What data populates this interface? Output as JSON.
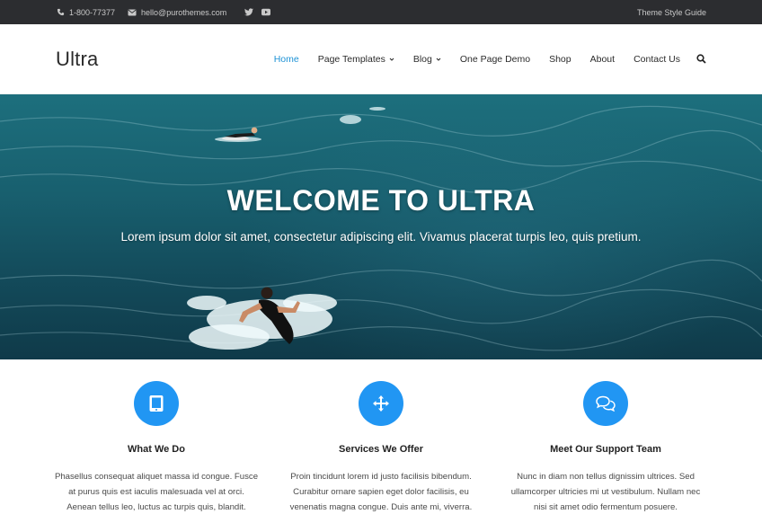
{
  "topbar": {
    "phone": "1-800-77377",
    "email": "hello@purothemes.com",
    "right_link": "Theme Style Guide",
    "icons": [
      "phone-icon",
      "mail-icon",
      "twitter-icon",
      "youtube-icon"
    ]
  },
  "header": {
    "logo": "Ultra",
    "nav": [
      {
        "label": "Home",
        "active": true,
        "dropdown": false
      },
      {
        "label": "Page Templates",
        "active": false,
        "dropdown": true
      },
      {
        "label": "Blog",
        "active": false,
        "dropdown": true
      },
      {
        "label": "One Page Demo",
        "active": false,
        "dropdown": false
      },
      {
        "label": "Shop",
        "active": false,
        "dropdown": false
      },
      {
        "label": "About",
        "active": false,
        "dropdown": false
      },
      {
        "label": "Contact Us",
        "active": false,
        "dropdown": false
      }
    ],
    "search_icon": "search-icon"
  },
  "hero": {
    "title": "WELCOME TO ULTRA",
    "subtitle": "Lorem ipsum dolor sit amet, consectetur adipiscing elit. Vivamus placerat turpis leo, quis pretium."
  },
  "features": [
    {
      "icon": "tablet-icon",
      "title": "What We Do",
      "lines": [
        "Phasellus consequat aliquet massa id congue. Fusce",
        "at purus quis est iaculis malesuada vel at orci.",
        "Aenean tellus leo, luctus ac turpis quis, blandit."
      ]
    },
    {
      "icon": "move-arrows-icon",
      "title": "Services We Offer",
      "lines": [
        "Proin tincidunt lorem id justo facilisis bibendum.",
        "Curabitur ornare sapien eget dolor facilisis, eu",
        "venenatis magna congue. Duis ante mi, viverra."
      ]
    },
    {
      "icon": "chat-bubbles-icon",
      "title": "Meet Our Support Team",
      "lines": [
        "Nunc in diam non tellus dignissim ultrices. Sed",
        "ullamcorper ultricies mi ut vestibulum. Nullam nec",
        "nisi sit amet odio fermentum posuere."
      ]
    }
  ],
  "colors": {
    "accent": "#2196f3",
    "nav_active": "#1f93d6",
    "topbar_bg": "#2c2d30"
  }
}
